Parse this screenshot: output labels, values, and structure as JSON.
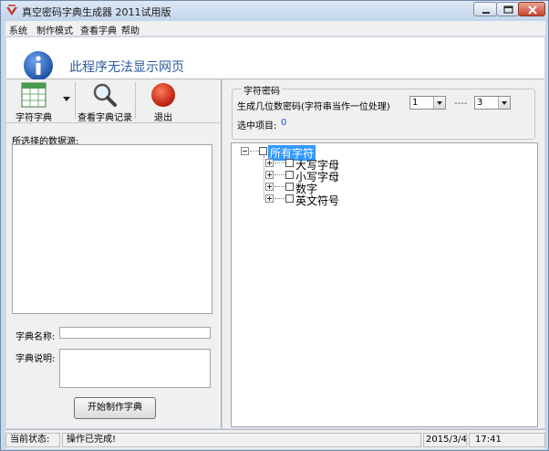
{
  "window": {
    "title": "真空密码字典生成器 2011试用版"
  },
  "menu": [
    "系统",
    "制作模式",
    "查看字典",
    "帮助"
  ],
  "banner": {
    "text": "此程序无法显示网页"
  },
  "toolbar": {
    "dict": "字符字典",
    "history": "查看字典记录",
    "exit": "退出"
  },
  "left": {
    "source_label": "所选择的数据源:",
    "name_label": "字典名称:",
    "desc_label": "字典说明:",
    "start_button": "开始制作字典"
  },
  "charset": {
    "group_title": "字符密码",
    "length_label": "生成几位数密码(字符串当作一位处理)",
    "from_value": "1",
    "dash": "----",
    "to_value": "3",
    "selected_label": "选中项目:",
    "selected_count": "0"
  },
  "tree": {
    "root": "所有字符",
    "items": [
      "大写字母",
      "小写字母",
      "数字",
      "英文符号"
    ]
  },
  "status": {
    "label": "当前状态:",
    "message": "操作已完成!",
    "date": "2015/3/4",
    "time": "17:41"
  },
  "colors": {
    "accent_blue": "#2d5aa0",
    "selection": "#3399ff",
    "count_blue": "#1e50c8"
  }
}
